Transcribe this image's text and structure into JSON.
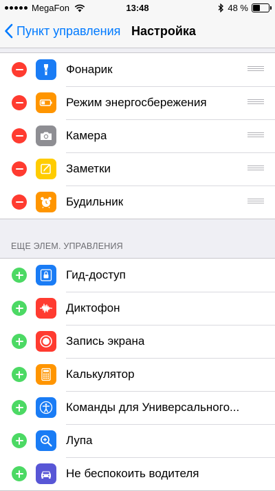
{
  "status": {
    "carrier": "MegaFon",
    "time": "13:48",
    "battery": "48 %",
    "battery_level": 0.48
  },
  "nav": {
    "back_label": "Пункт управления",
    "title": "Настройка"
  },
  "included": [
    {
      "label": "Фонарик",
      "icon": "flashlight-icon",
      "color": "#1a7cf5"
    },
    {
      "label": "Режим энергосбережения",
      "icon": "battery-low-power-icon",
      "color": "#ff9500"
    },
    {
      "label": "Камера",
      "icon": "camera-icon",
      "color": "#8e8e93"
    },
    {
      "label": "Заметки",
      "icon": "notes-icon",
      "color": "#ffcc00"
    },
    {
      "label": "Будильник",
      "icon": "alarm-clock-icon",
      "color": "#ff9500"
    }
  ],
  "more_header": "ЕЩЕ ЭЛЕМ. УПРАВЛЕНИЯ",
  "more": [
    {
      "label": "Гид-доступ",
      "icon": "lock-icon",
      "color": "#1a7cf5"
    },
    {
      "label": "Диктофон",
      "icon": "voice-memo-icon",
      "color": "#ff3b30"
    },
    {
      "label": "Запись экрана",
      "icon": "screen-record-icon",
      "color": "#ff3b30"
    },
    {
      "label": "Калькулятор",
      "icon": "calculator-icon",
      "color": "#ff9500"
    },
    {
      "label": "Команды для Универсального...",
      "icon": "accessibility-icon",
      "color": "#1a7cf5"
    },
    {
      "label": "Лупа",
      "icon": "magnifier-icon",
      "color": "#1a7cf5"
    },
    {
      "label": "Не беспокоить водителя",
      "icon": "car-icon",
      "color": "#5856d6"
    }
  ]
}
